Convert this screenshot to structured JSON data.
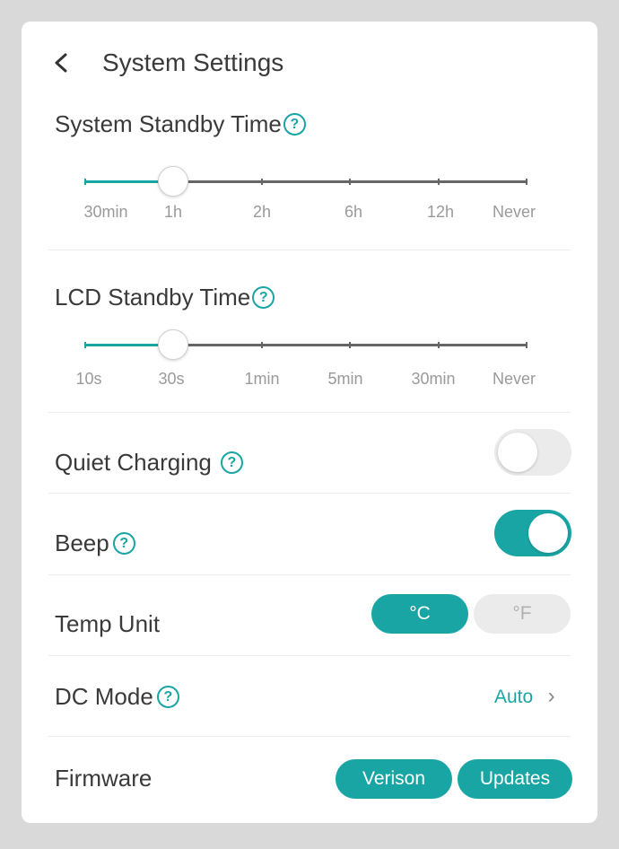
{
  "header": {
    "title": "System Settings"
  },
  "system_standby": {
    "title": "System Standby Time",
    "ticks": [
      "30min",
      "1h",
      "2h",
      "6h",
      "12h",
      "Never"
    ],
    "selected": "1h"
  },
  "lcd_standby": {
    "title": "LCD Standby Time",
    "ticks": [
      "10s",
      "30s",
      "1min",
      "5min",
      "30min",
      "Never"
    ],
    "selected": "30s"
  },
  "quiet_charging": {
    "label": "Quiet Charging",
    "enabled": false
  },
  "beep": {
    "label": "Beep",
    "enabled": true
  },
  "temp_unit": {
    "label": "Temp Unit",
    "options": [
      "°C",
      "°F"
    ],
    "selected": "°C"
  },
  "dc_mode": {
    "label": "DC Mode",
    "value": "Auto"
  },
  "firmware": {
    "label": "Firmware",
    "version_button": "Verison",
    "updates_button": "Updates"
  },
  "icons": {
    "back": "chevron-left-icon",
    "help": "help-circle-icon",
    "arrow": "chevron-right-icon"
  },
  "colors": {
    "accent": "#1aa5a5",
    "background": "#d9d9d9",
    "card": "#ffffff"
  }
}
